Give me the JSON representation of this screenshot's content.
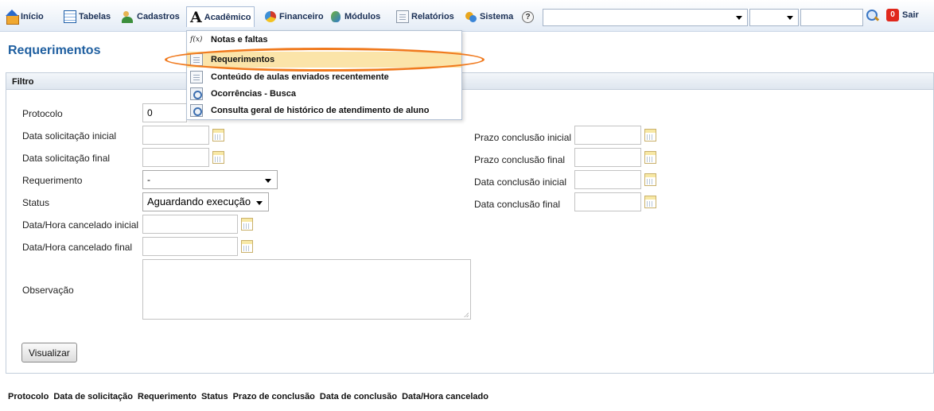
{
  "menu": {
    "items": [
      {
        "key": "home",
        "label": "Início"
      },
      {
        "key": "tables",
        "label": "Tabelas"
      },
      {
        "key": "registers",
        "label": "Cadastros"
      },
      {
        "key": "academic",
        "label": "Acadêmico"
      },
      {
        "key": "financial",
        "label": "Financeiro"
      },
      {
        "key": "modules",
        "label": "Módulos"
      },
      {
        "key": "reports",
        "label": "Relatórios"
      },
      {
        "key": "system",
        "label": "Sistema"
      }
    ],
    "help_glyph": "?",
    "logout_label": "Sair",
    "power_glyph": "0"
  },
  "dropdown": {
    "items": [
      {
        "label": "Notas e faltas",
        "icon": "fx-icon",
        "fx_text": "f(x)"
      },
      {
        "label": "Requerimentos",
        "icon": "document-icon",
        "highlighted": true
      },
      {
        "label": "Conteúdo de aulas enviados recentemente",
        "icon": "document-icon"
      },
      {
        "label": "Ocorrências - Busca",
        "icon": "search-document-icon"
      },
      {
        "label": "Consulta geral de histórico de atendimento de aluno",
        "icon": "search-document-icon"
      }
    ]
  },
  "page": {
    "title": "Requerimentos"
  },
  "filter": {
    "header": "Filtro",
    "protocolo_label": "Protocolo",
    "protocolo_value": "0",
    "data_solicitacao_inicial_label": "Data solicitação inicial",
    "data_solicitacao_final_label": "Data solicitação final",
    "requerimento_label": "Requerimento",
    "requerimento_value": "-",
    "status_label": "Status",
    "status_value": "Aguardando execução",
    "cancelado_inicial_label": "Data/Hora cancelado inicial",
    "cancelado_final_label": "Data/Hora cancelado final",
    "observacao_label": "Observação",
    "prazo_inicial_label": "Prazo conclusão inicial",
    "prazo_final_label": "Prazo conclusão final",
    "conclusao_inicial_label": "Data conclusão inicial",
    "conclusao_final_label": "Data conclusão final",
    "button_label": "Visualizar"
  },
  "results": {
    "columns": [
      "Protocolo",
      "Data de solicitação",
      "Requerimento",
      "Status",
      "Prazo de conclusão",
      "Data de conclusão",
      "Data/Hora cancelado"
    ]
  },
  "colors": {
    "title": "#1f5fa0",
    "highlight_ring": "#f07a1e",
    "highlight_row": "#fbe4a9"
  }
}
